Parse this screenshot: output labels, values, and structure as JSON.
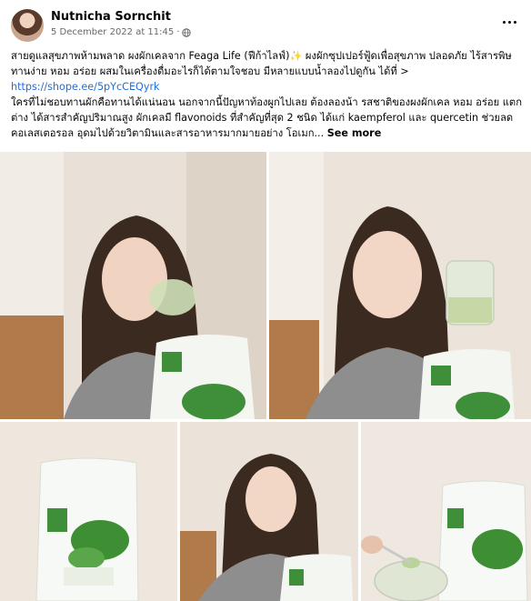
{
  "post": {
    "author": "Nutnicha Sornchit",
    "date": "5 December 2022 at 11:45",
    "separator": "·",
    "text_line1": "สายดูแลสุขภาพห้ามพลาด ผงผักเคลจาก Feaga Life (ฟีก้าไลฟ์)✨ ผงผักซุปเปอร์ฟู้ดเพื่อสุขภาพ ปลอดภัย ไร้สารพิษ ทานง่าย หอม อร่อย ผสมในเครื่องดื่มอะไรก็ได้ตามใจชอบ มีหลายแบบน้ำลองไปดูกัน ได้ที่ > ",
    "link": "https://shope.ee/5pYcCEQyrk",
    "text_line2": "ใครที่ไม่ชอบทานผักคือทานได้แน่นอน นอกจากนี้ปัญหาท้องผูกไปเลย ต้องลองน้า รสชาติของผงผักเคล หอม อร่อย แตกต่าง ได้สารสำคัญปริมาณสูง ผักเคลมี flavonoids ที่สำคัญที่สุด 2 ชนิด ได้แก่ kaempferol และ quercetin ช่วยลดคอเลสเตอรอล อุดมไปด้วยวิตามินและสารอาหารมากมายอย่าง โอเมก... ",
    "see_more": "See more"
  },
  "icons": {
    "globe": "globe-icon",
    "more": "more-options-icon"
  },
  "colors": {
    "link": "#216fdb",
    "meta": "#65676b",
    "product_green": "#3f8f3a"
  }
}
